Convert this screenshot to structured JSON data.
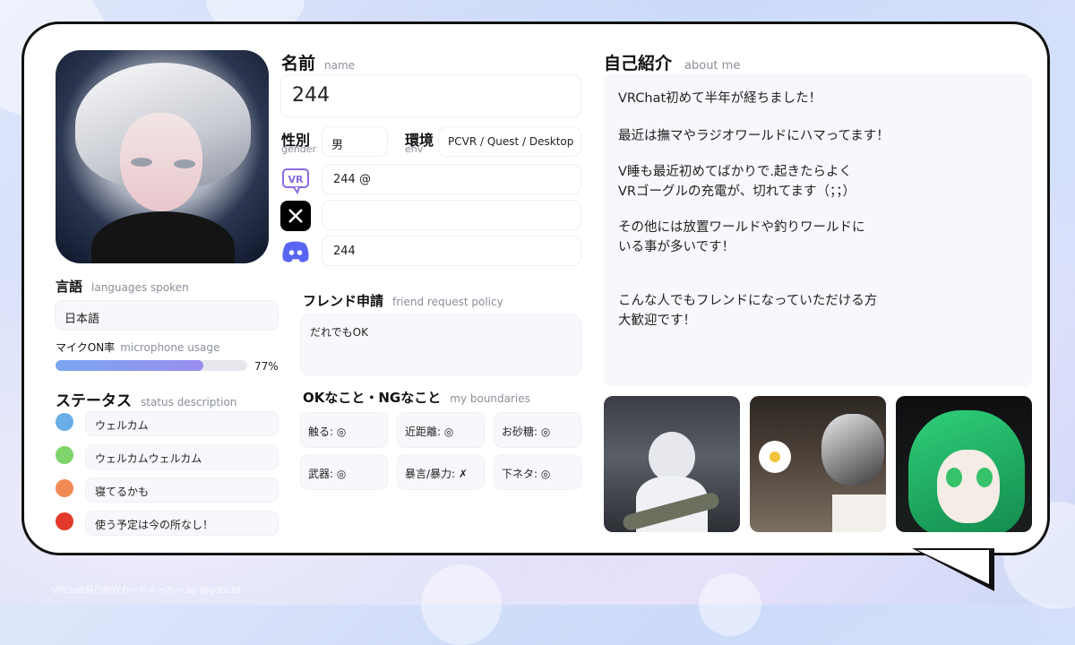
{
  "colors": {
    "accent_bar": "#8b93ee",
    "dot_green_blue": "#6aaee8",
    "dot_green": "#7ed36a",
    "dot_orange": "#f08a55",
    "dot_red": "#e23a2a",
    "discord": "#5865f2",
    "vrchat": "#8a6ae0"
  },
  "name": {
    "label": "名前",
    "sub": "name",
    "value": "244"
  },
  "gender": {
    "label": "性別",
    "sub": "gender",
    "value": "男"
  },
  "env": {
    "label": "環境",
    "sub": "env",
    "value": "PCVR / Quest / Desktop"
  },
  "socials": [
    {
      "icon": "vrchat-icon",
      "value": "244 @"
    },
    {
      "icon": "x-icon",
      "value": ""
    },
    {
      "icon": "discord-icon",
      "value": "244"
    }
  ],
  "languages": {
    "label": "言語",
    "sub": "languages spoken",
    "value": "日本語"
  },
  "mic": {
    "label": "マイクON率",
    "sub": "microphone usage",
    "value_text": "77%",
    "value": 0.77
  },
  "status": {
    "label": "ステータス",
    "sub": "status description",
    "items": [
      {
        "color": "#6aaee8",
        "text": "ウェルカム"
      },
      {
        "color": "#7ed36a",
        "text": "ウェルカムウェルカム"
      },
      {
        "color": "#f08a55",
        "text": "寝てるかも"
      },
      {
        "color": "#e23a2a",
        "text": "使う予定は今の所なし！"
      }
    ]
  },
  "friend": {
    "label": "フレンド申請",
    "sub": "friend request policy",
    "value": "だれでもOK"
  },
  "boundaries": {
    "label": "OKなこと・NGなこと",
    "sub": "my boundaries",
    "items": [
      "触る: ◎",
      "近距離: ◎",
      "お砂糖: ◎",
      "武器: ◎",
      "暴言/暴力: ✗",
      "下ネタ: ◎"
    ]
  },
  "about": {
    "label": "自己紹介",
    "sub": "about me",
    "lines": [
      "VRChat初めて半年が経ちました！",
      "最近は撫マやラジオワールドにハマってます！",
      "V睡も最近初めてばかりで.起きたらよく",
      "VRゴーグルの充電が、切れてます（；；）",
      "その他には放置ワールドや釣りワールドに",
      "いる事が多いです！",
      "こんな人でもフレンドになっていただける方",
      "大歓迎です！"
    ]
  },
  "footer": "VRChat自己紹介カードメーカー by @yota3d"
}
